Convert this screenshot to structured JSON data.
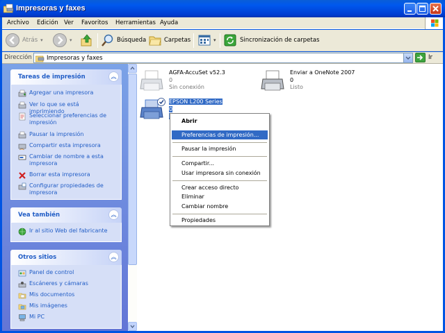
{
  "window": {
    "title": "Impresoras y faxes"
  },
  "menu": [
    "Archivo",
    "Edición",
    "Ver",
    "Favoritos",
    "Herramientas",
    "Ayuda"
  ],
  "toolbar": {
    "back": "Atrás",
    "search": "Búsqueda",
    "folders": "Carpetas",
    "sync": "Sincronización de carpetas"
  },
  "address": {
    "label": "Dirección",
    "value": "Impresoras y faxes",
    "go": "Ir"
  },
  "tasks": {
    "title": "Tareas de impresión",
    "items": [
      "Agregar una impresora",
      "Ver lo que se está imprimiendo",
      "Seleccionar preferencias de impresión",
      "Pausar la impresión",
      "Compartir esta impresora",
      "Cambiar de nombre a esta impresora",
      "Borrar esta impresora",
      "Configurar propiedades de impresora"
    ]
  },
  "see_also": {
    "title": "Vea también",
    "items": [
      "Ir al sitio Web del fabricante"
    ]
  },
  "other_places": {
    "title": "Otros sitios",
    "items": [
      "Panel de control",
      "Escáneres y cámaras",
      "Mis documentos",
      "Mis imágenes",
      "Mi PC"
    ]
  },
  "printers": [
    {
      "name": "AGFA-AccuSet v52.3",
      "docs": "0",
      "status": "Sin conexión"
    },
    {
      "name": "Enviar a OneNote 2007",
      "docs": "0",
      "status": "Listo"
    },
    {
      "name": "EPSON L200 Series",
      "docs": "0",
      "status": "L"
    }
  ],
  "context_menu": {
    "open": "Abrir",
    "prefs": "Preferencias de impresión...",
    "pause": "Pausar la impresión",
    "share": "Compartir...",
    "offline": "Usar impresora sin conexión",
    "shortcut": "Crear acceso directo",
    "delete": "Eliminar",
    "rename": "Cambiar nombre",
    "properties": "Propiedades"
  }
}
